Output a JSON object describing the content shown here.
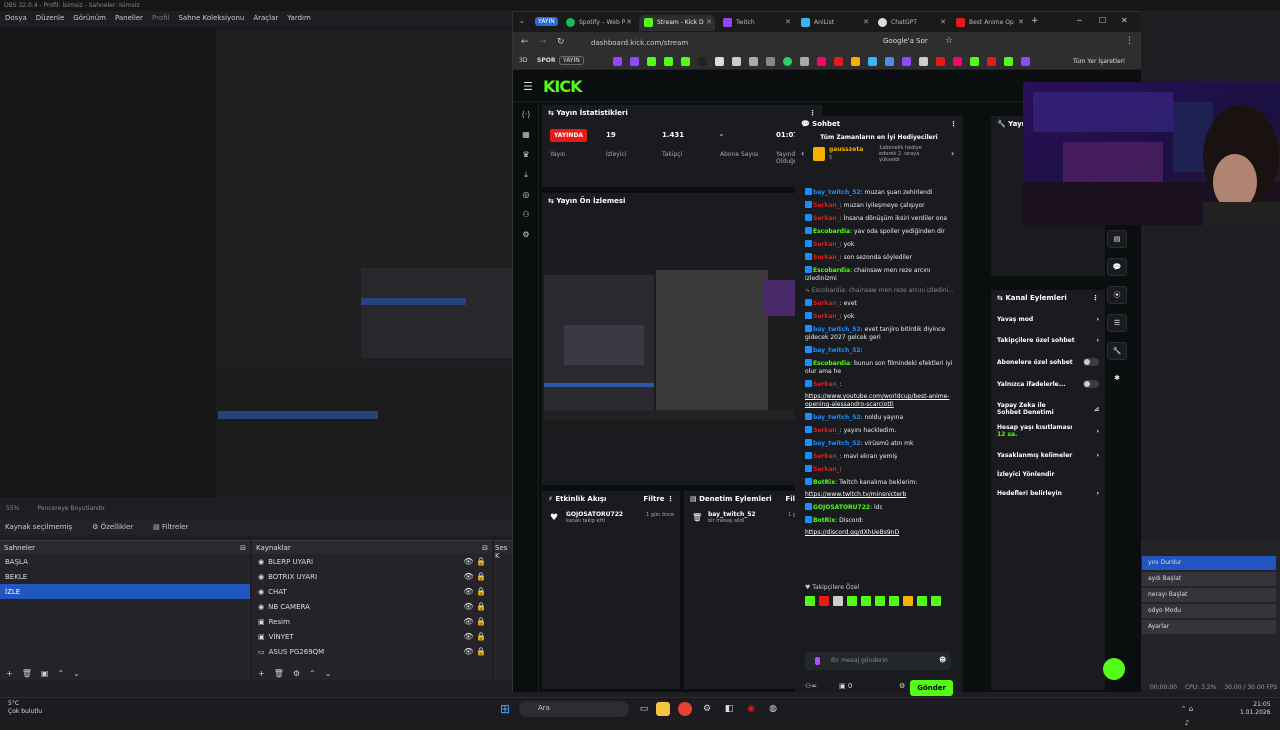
{
  "obs": {
    "title": "OBS 32.0.4 - Profil: İsimsiz - Sahneler: İsimsiz",
    "menu": [
      "Dosya",
      "Düzenle",
      "Görünüm",
      "Paneller",
      "Profil",
      "Sahne Koleksiyonu",
      "Araçlar",
      "Yardım"
    ],
    "zoom": "55%",
    "fit_label": "Pencereye Boyutlandır",
    "source_selected": "Kaynak seçilmemiş",
    "props_label": "Özellikler",
    "filters_label": "Filtreler",
    "scenes_title": "Sahneler",
    "scenes": [
      "BAŞLA",
      "BEKLE",
      "İZLE"
    ],
    "sources_title": "Kaynaklar",
    "sources": [
      "BLERP UYARI",
      "BOTRIX UYARI",
      "CHAT",
      "NB CAMERA",
      "Resim",
      "VİNYET",
      "ASUS PG269QM"
    ],
    "mixer_title": "Ses K",
    "controls": [
      "yını Durdur",
      "aydı Başlat",
      "nerayı Başlat",
      "odyo Modu",
      "Ayarlar"
    ],
    "status_time": "00:00:00",
    "status_cpu": "CPU: 3.2%",
    "status_fps": "30.00 / 30.00 FPS"
  },
  "taskbar": {
    "weather_temp": "5°C",
    "weather_desc": "Çok bulutlu",
    "search": "Ara",
    "time": "21:05",
    "date": "1.01.2026"
  },
  "browser": {
    "tabs": [
      {
        "label": "YAYIN",
        "type": "group"
      },
      {
        "label": "Spotify – Web P",
        "color": "#1db954"
      },
      {
        "label": "Stream - Kick D",
        "color": "#53fc18"
      },
      {
        "label": "Twitch",
        "color": "#9146ff"
      },
      {
        "label": "AniList",
        "color": "#3db4f2"
      },
      {
        "label": "ChatGPT",
        "color": "#ddd"
      },
      {
        "label": "Best Anime Op",
        "color": "#e91916"
      }
    ],
    "url": "dashboard.kick.com/stream",
    "google_btn": "Google'a Sor",
    "bookmarks_label_3d": "3D",
    "bookmarks_spor": "SPOR",
    "bookmarks_yayin": "YAYIN",
    "all_bookmarks": "Tüm Yer İşaretleri"
  },
  "kick": {
    "logo": "KICK",
    "stats": {
      "title": "Yayın İstatistikleri",
      "live": "YAYINDA",
      "live_label": "Yayın",
      "viewers": "19",
      "viewers_label": "İzleyici",
      "followers": "1.431",
      "followers_label": "Takipçi",
      "subs": "-",
      "subs_label": "Abone Sayısı",
      "duration": "01:07:55",
      "duration_label": "Yayında Olduğu Süre"
    },
    "preview_title": "Yayın Ön İzlemesi",
    "activity": {
      "title": "Etkinlik Akışı",
      "filter": "Filtre",
      "user": "GOJOSATORU722",
      "text": "kanalı takip etti",
      "time": "1 gün önce"
    },
    "moderation": {
      "title": "Denetim Eylemleri",
      "filter": "Filtre",
      "user": "bay_twitch_52",
      "text": "bir mesajı sildi",
      "time": "1 gün önce"
    },
    "chat": {
      "title": "Sohbet",
      "top_gifters": "Tüm Zamanların en İyi Hediyecileri",
      "gifter_name": "gausszeta",
      "gifter_count": "5",
      "gifter_note": "1abonelik hediye ederek 2. sıraya yükseldi",
      "messages": [
        {
          "user": "bay_twitch_52",
          "color": "#1a8dff",
          "text": "muzan şuan zehirlendi"
        },
        {
          "user": "Serkan_",
          "color": "#e91916",
          "text": "muzan iyileşmeye çalışıyor"
        },
        {
          "user": "Serkan_",
          "color": "#e91916",
          "text": "İnsana dönüşüm iksiri verdiler ona"
        },
        {
          "user": "Escobardia",
          "color": "#53fc18",
          "text": "yav oda spoiler yediğinden dir"
        },
        {
          "user": "Serkan_",
          "color": "#e91916",
          "text": "yok"
        },
        {
          "user": "Serkan_",
          "color": "#e91916",
          "text": "son sezonda söylediler"
        },
        {
          "user": "Escobardia",
          "color": "#53fc18",
          "text": "chainsaw men reze arcını izledinizmi"
        },
        {
          "user": "",
          "color": "#888",
          "text": "↳ Escobardia: chainsaw men reze arcını izledini..."
        },
        {
          "user": "Serkan_",
          "color": "#e91916",
          "text": "evet"
        },
        {
          "user": "Serkan_",
          "color": "#e91916",
          "text": "yok"
        },
        {
          "user": "bay_twitch_52",
          "color": "#1a8dff",
          "text": "evet tanjiro bitirdik diyince gidecek 2027 gelcek geri"
        },
        {
          "user": "bay_twitch_52",
          "color": "#1a8dff",
          "text": ""
        },
        {
          "user": "Escobardia",
          "color": "#53fc18",
          "text": "bunun son filmindeki efektleri iyi olur ama he"
        },
        {
          "user": "Serkan_",
          "color": "#e91916",
          "text": ""
        },
        {
          "user": "",
          "color": "#fff",
          "text": "https://www.youtube.com/worldcup/best-anime-opening-alessandro-scarciotti"
        },
        {
          "user": "bay_twitch_52",
          "color": "#1a8dff",
          "text": "noldu yayına"
        },
        {
          "user": "Serkan_",
          "color": "#e91916",
          "text": "yayını hackledim."
        },
        {
          "user": "bay_twitch_52",
          "color": "#1a8dff",
          "text": "virüsmü atın mk"
        },
        {
          "user": "Serkan_",
          "color": "#e91916",
          "text": "mavi ekran yemiş"
        },
        {
          "user": "Serkan_",
          "color": "#e91916",
          "text": ""
        },
        {
          "user": "BotRix",
          "color": "#53fc18",
          "text": "Twitch kanalıma beklerim:"
        },
        {
          "user": "",
          "color": "#fff",
          "text": "https://www.twitch.tv/minsnicterb"
        },
        {
          "user": "GOJOSATORU722",
          "color": "#53fc18",
          "text": "ldc"
        },
        {
          "user": "BotRix",
          "color": "#53fc18",
          "text": "Discord:"
        },
        {
          "user": "",
          "color": "#fff",
          "text": "https://discord.gg/dXhUeBs9nD"
        }
      ],
      "followers_only": "Takipçilere Özel",
      "placeholder": "Bir mesaj gönderin",
      "send": "Gönder",
      "count_left": "0"
    },
    "actions": {
      "title": "Kanal Eylemleri",
      "items": [
        "Yavaş mod",
        "Takipçilere özel sohbet",
        "Abonelere özel sohbet",
        "Yalnızca ifadelerle...",
        "Yapay Zeka ile Sohbet Denetimi",
        "Hesap yaşı kısıtlaması",
        "Yasaklanmış kelimeler",
        "İzleyici Yönlendir",
        "Hedefleri belirleyin"
      ],
      "age_note": "12 sa.",
      "partial_title": "Yayı"
    }
  }
}
